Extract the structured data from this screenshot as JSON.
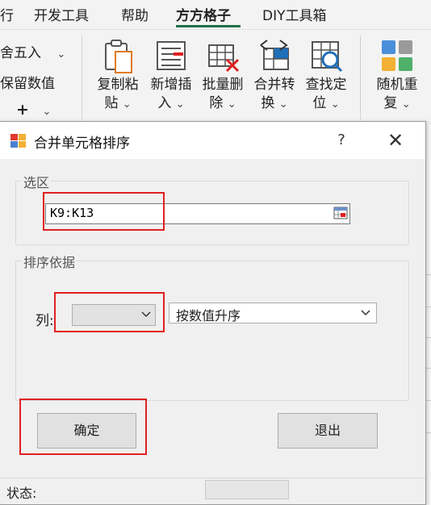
{
  "ribbon": {
    "tabs": [
      {
        "label": "行"
      },
      {
        "label": "开发工具"
      },
      {
        "label": "帮助"
      },
      {
        "label": "方方格子"
      },
      {
        "label": "DIY工具箱"
      }
    ],
    "left_items": {
      "round": "舍五入",
      "keep_value": "保留数值",
      "add_symbol": "+"
    },
    "buttons": [
      {
        "line1": "复制粘",
        "line2": "贴"
      },
      {
        "line1": "新增插",
        "line2": "入"
      },
      {
        "line1": "批量删",
        "line2": "除"
      },
      {
        "line1": "合并转",
        "line2": "换"
      },
      {
        "line1": "查找定",
        "line2": "位"
      },
      {
        "line1": "随机重",
        "line2": "复"
      }
    ],
    "chevron": "⌄"
  },
  "dialog": {
    "title": "合并单元格排序",
    "help": "?",
    "close": "✕",
    "selection_group": "选区",
    "range_value": "K9:K13",
    "sort_group": "排序依据",
    "column_label": "列:",
    "column_value": "",
    "sort_order": "按数值升序",
    "ok_label": "确定",
    "exit_label": "退出",
    "status_label": "状态:"
  },
  "colors": {
    "accent_green": "#1e7145",
    "highlight_red": "#e02020"
  }
}
